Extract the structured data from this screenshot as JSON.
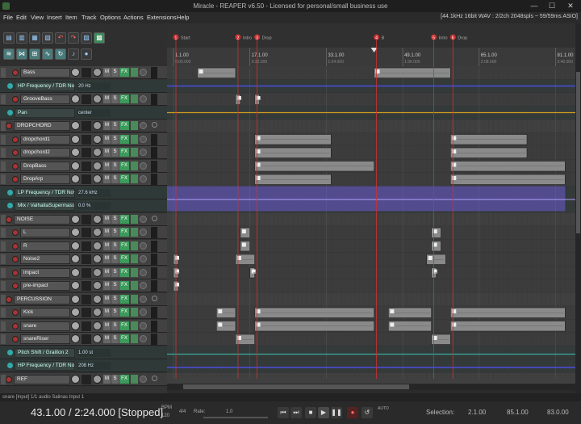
{
  "window": {
    "title": "Miracle - REAPER v6.50 - Licensed for personal/small business use",
    "min": "—",
    "max": "☐",
    "close": "✕"
  },
  "menu": {
    "items": [
      "File",
      "Edit",
      "View",
      "Insert",
      "Item",
      "Track",
      "Options",
      "Actions",
      "Extensions",
      "Help"
    ],
    "status": "[44.1kHz 16bit WAV : 2/2ch 2048spls ~ 59/59ms ASIO]"
  },
  "toolbar": {
    "icons": [
      "new-project-icon",
      "open-project-icon",
      "save-project-icon",
      "project-settings-icon",
      "undo-icon",
      "redo-icon",
      "grid-icon",
      "snap-icon",
      "ripple-icon",
      "auto-crossfade-icon",
      "locking-icon",
      "envelope-points-icon",
      "metronome-icon"
    ]
  },
  "markers": [
    {
      "num": "1",
      "label": "Start"
    },
    {
      "num": "2",
      "label": "Intro"
    },
    {
      "num": "3",
      "label": "Drop"
    },
    {
      "num": "4",
      "label": "B"
    },
    {
      "num": "5",
      "label": "Intro"
    },
    {
      "num": "6",
      "label": "Drop"
    }
  ],
  "ruler": [
    {
      "bar": "1.1.00",
      "time": "0:00.000"
    },
    {
      "bar": "17.1.00",
      "time": "0:32.000"
    },
    {
      "bar": "33.1.00",
      "time": "1:04.000"
    },
    {
      "bar": "49.1.00",
      "time": "1:36.000"
    },
    {
      "bar": "65.1.00",
      "time": "2:08.000"
    },
    {
      "bar": "81.1.00",
      "time": "2:40.000"
    }
  ],
  "tracks": [
    {
      "name": "Bass",
      "kind": "child"
    },
    {
      "name": "HP Frequency / TDR Nova",
      "kind": "env",
      "value": "20 Hz"
    },
    {
      "name": "GrooveBass",
      "kind": "child"
    },
    {
      "name": "Pan",
      "kind": "env",
      "value": "center"
    },
    {
      "name": "DROPCHORD",
      "kind": "folder"
    },
    {
      "name": "dropchord1",
      "kind": "child"
    },
    {
      "name": "dropchord2",
      "kind": "child"
    },
    {
      "name": "DropBass",
      "kind": "child"
    },
    {
      "name": "DropArp",
      "kind": "child"
    },
    {
      "name": "LP Frequency / TDR Nova",
      "kind": "env",
      "value": "27.6 kHz"
    },
    {
      "name": "Mix / ValhallaSupermassive",
      "kind": "env",
      "value": "0.0 %"
    },
    {
      "name": "NOISE",
      "kind": "folder"
    },
    {
      "name": "L",
      "kind": "child"
    },
    {
      "name": "R",
      "kind": "child"
    },
    {
      "name": "Noise2",
      "kind": "child"
    },
    {
      "name": "impact",
      "kind": "child"
    },
    {
      "name": "pre-impact",
      "kind": "child"
    },
    {
      "name": "PERCUSSION",
      "kind": "folder"
    },
    {
      "name": "Kick",
      "kind": "child"
    },
    {
      "name": "snare",
      "kind": "child"
    },
    {
      "name": "snareRiser",
      "kind": "child"
    },
    {
      "name": "Pitch Shift / Graillon 2",
      "kind": "env",
      "value": "1.00 st"
    },
    {
      "name": "HP Frequency / TDR Nov",
      "kind": "env",
      "value": "208 Hz"
    },
    {
      "name": "REF",
      "kind": "folder"
    }
  ],
  "status_line": "snare [Input] 1/1 audio Salinas Input 1",
  "transport": {
    "position": "43.1.00 / 2:24.000 [Stopped]",
    "bpm_label": "BPM",
    "bpm": "120",
    "sig_label": "4/4",
    "rate_label": "Rate:",
    "rate": "1.0",
    "selection_label": "Selection:",
    "sel_start": "2.1.00",
    "sel_end": "85.1.00",
    "sel_len": "83.0.00"
  },
  "colors": {
    "accent": "#3c9a5a",
    "marker": "#cc3333",
    "envelope_blue": "#5050ff",
    "envelope_orange": "#d4a020",
    "envelope_teal": "#3aaa9a"
  }
}
